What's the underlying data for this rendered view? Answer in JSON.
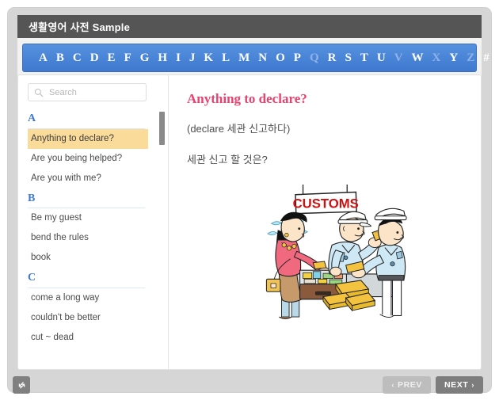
{
  "window": {
    "title": "생활영어 사전 Sample"
  },
  "alphabet": {
    "letters": [
      {
        "label": "A",
        "enabled": true
      },
      {
        "label": "B",
        "enabled": true
      },
      {
        "label": "C",
        "enabled": true
      },
      {
        "label": "D",
        "enabled": true
      },
      {
        "label": "E",
        "enabled": true
      },
      {
        "label": "F",
        "enabled": true
      },
      {
        "label": "G",
        "enabled": true
      },
      {
        "label": "H",
        "enabled": true
      },
      {
        "label": "I",
        "enabled": true
      },
      {
        "label": "J",
        "enabled": true
      },
      {
        "label": "K",
        "enabled": true
      },
      {
        "label": "L",
        "enabled": true
      },
      {
        "label": "M",
        "enabled": true
      },
      {
        "label": "N",
        "enabled": true
      },
      {
        "label": "O",
        "enabled": true
      },
      {
        "label": "P",
        "enabled": true
      },
      {
        "label": "Q",
        "enabled": false
      },
      {
        "label": "R",
        "enabled": true
      },
      {
        "label": "S",
        "enabled": true
      },
      {
        "label": "T",
        "enabled": true
      },
      {
        "label": "U",
        "enabled": true
      },
      {
        "label": "V",
        "enabled": false
      },
      {
        "label": "W",
        "enabled": true
      },
      {
        "label": "X",
        "enabled": false
      },
      {
        "label": "Y",
        "enabled": true
      },
      {
        "label": "Z",
        "enabled": false
      },
      {
        "label": "#",
        "enabled": true
      }
    ],
    "active_color": "#ffffff",
    "disabled_color": "#8fb3e6",
    "bar_color": "#4a84d8"
  },
  "sidebar": {
    "search": {
      "placeholder": "Search",
      "value": "",
      "icon": "search-icon"
    },
    "groups": [
      {
        "letter": "A",
        "entries": [
          {
            "label": "Anything to declare?",
            "active": true
          },
          {
            "label": "Are you being helped?",
            "active": false
          },
          {
            "label": "Are you with me?",
            "active": false
          }
        ]
      },
      {
        "letter": "B",
        "entries": [
          {
            "label": "Be my guest",
            "active": false
          },
          {
            "label": "bend the rules",
            "active": false
          },
          {
            "label": "book",
            "active": false
          }
        ]
      },
      {
        "letter": "C",
        "entries": [
          {
            "label": "come a long way",
            "active": false
          },
          {
            "label": "couldn't be better",
            "active": false
          },
          {
            "label": "cut ~ dead",
            "active": false
          }
        ]
      }
    ],
    "highlight_color": "#fbdb99",
    "letter_color": "#3f7ad0"
  },
  "main": {
    "title": "Anything to declare?",
    "title_color": "#e8426e",
    "gloss": "(declare 세관 신고하다)",
    "translation": "세관 신고 할 것은?",
    "illustration": {
      "name": "customs-inspection-cartoon",
      "sign_text": "CUSTOMS",
      "sign_color": "#cc1111"
    }
  },
  "footer": {
    "resize_icon": "resize-diagonal-icon",
    "prev_label": "PREV",
    "next_label": "NEXT",
    "prev_chevron": "‹",
    "next_chevron": "›",
    "prev_enabled": false,
    "next_enabled": true
  }
}
